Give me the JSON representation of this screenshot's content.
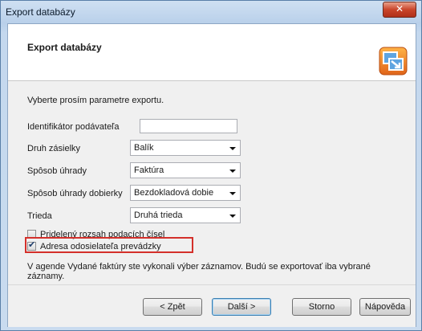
{
  "window": {
    "title": "Export databázy"
  },
  "header": {
    "title": "Export databázy",
    "icon": "export-wizard-icon"
  },
  "instruction": "Vyberte prosím parametre exportu.",
  "fields": {
    "sender_id": {
      "label": "Identifikátor podávateľa",
      "value": ""
    },
    "shipment_type": {
      "label": "Druh zásielky",
      "value": "Balík"
    },
    "payment_method": {
      "label": "Spôsob úhrady",
      "value": "Faktúra"
    },
    "cod_payment_method": {
      "label": "Spôsob úhrady dobierky",
      "value": "Bezdokladová dobie"
    },
    "class": {
      "label": "Trieda",
      "value": "Druhá trieda"
    }
  },
  "checkboxes": {
    "assigned_range": {
      "label": "Pridelený rozsah podacích čísel",
      "checked": false
    },
    "sender_address": {
      "label": "Adresa odosielateľa prevádzky",
      "checked": true
    }
  },
  "note": "V agende Vydané faktúry ste vykonali výber záznamov. Budú se exportovať iba vybrané záznamy.",
  "buttons": {
    "back": "< Zpět",
    "next": "Další >",
    "cancel": "Storno",
    "help": "Nápověda"
  },
  "colors": {
    "highlight": "#d4302b",
    "accent": "#3c7fb1"
  }
}
